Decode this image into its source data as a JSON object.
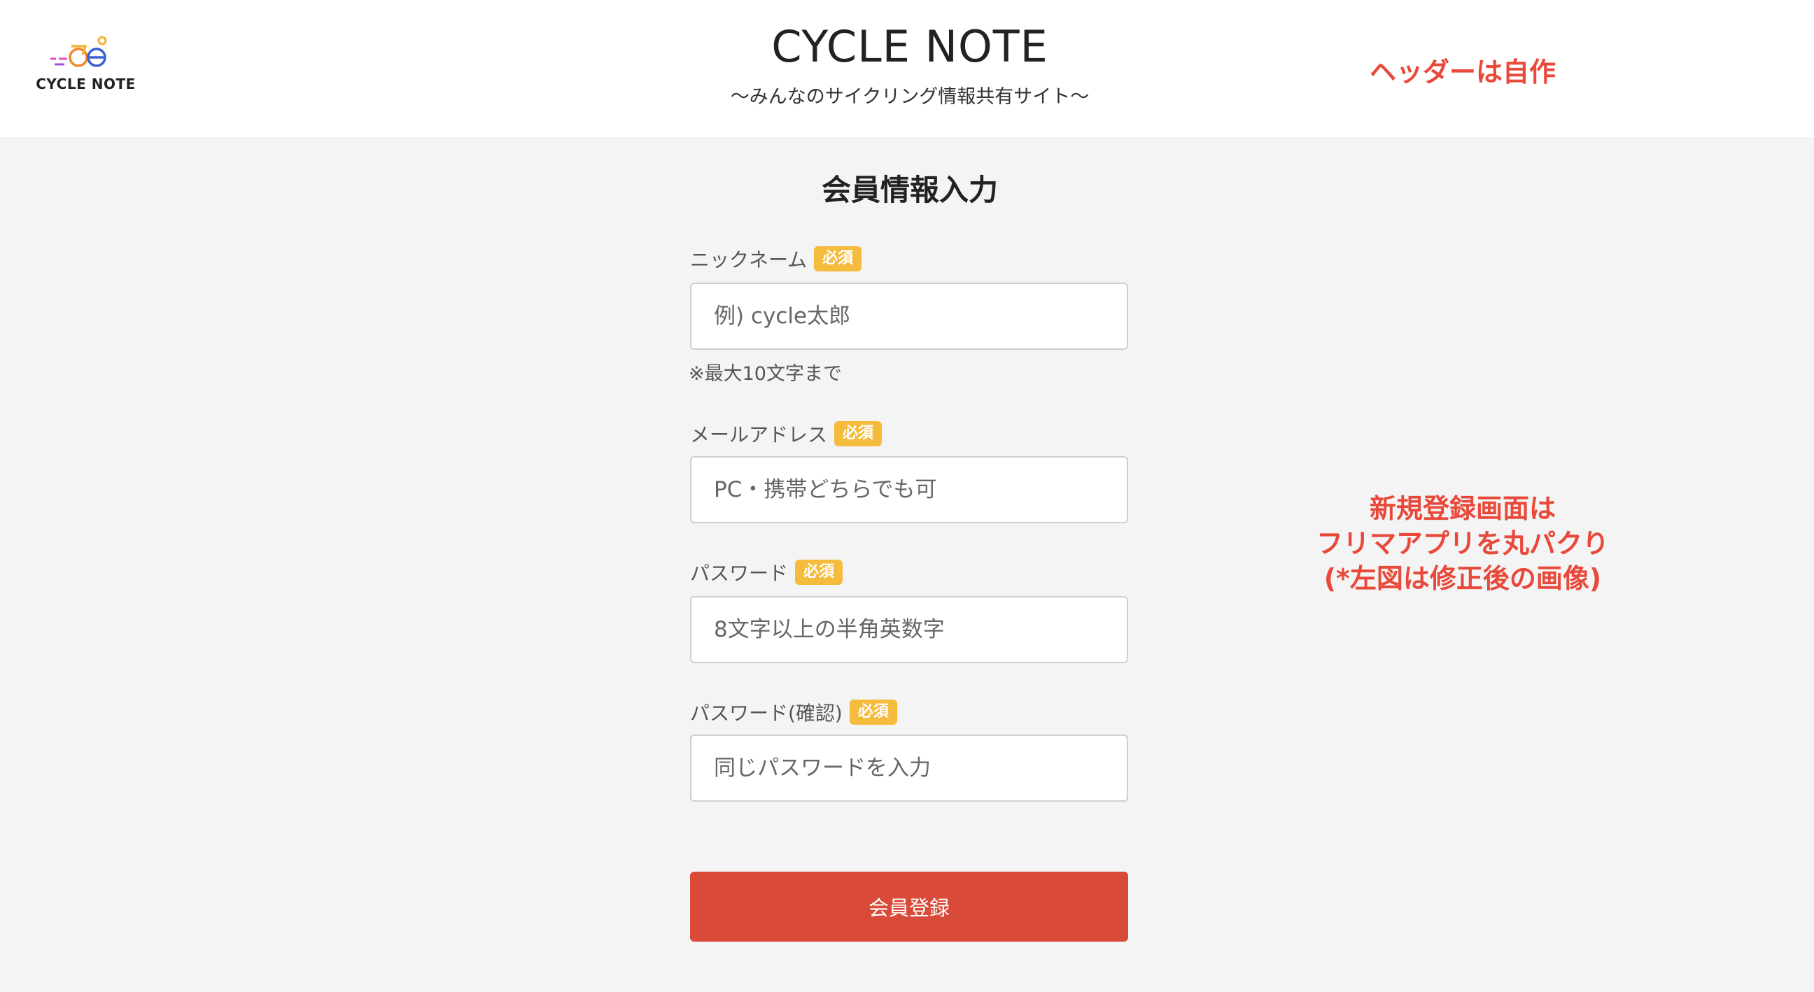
{
  "header": {
    "logo_text": "CYCLE NOTE",
    "title": "CYCLE NOTE",
    "subtitle": "〜みんなのサイクリング情報共有サイト〜"
  },
  "notes": {
    "header_note": "ヘッダーは自作",
    "form_note": [
      "新規登録画面は",
      "フリマアプリを丸パクり",
      "(*左図は修正後の画像)"
    ]
  },
  "form": {
    "title": "会員情報入力",
    "required_badge": "必須",
    "fields": [
      {
        "label": "ニックネーム",
        "placeholder": "例) cycle太郎",
        "hint": "※最大10文字まで"
      },
      {
        "label": "メールアドレス",
        "placeholder": "PC・携帯どちらでも可"
      },
      {
        "label": "パスワード",
        "placeholder": "8文字以上の半角英数字"
      },
      {
        "label": "パスワード(確認)",
        "placeholder": "同じパスワードを入力"
      }
    ],
    "submit_label": "会員登録"
  },
  "colors": {
    "badge": "#f5bb3c",
    "submit": "#d94a38",
    "note_text": "#e8493a"
  },
  "icons": {
    "logo": "bicycle-logo-icon"
  }
}
